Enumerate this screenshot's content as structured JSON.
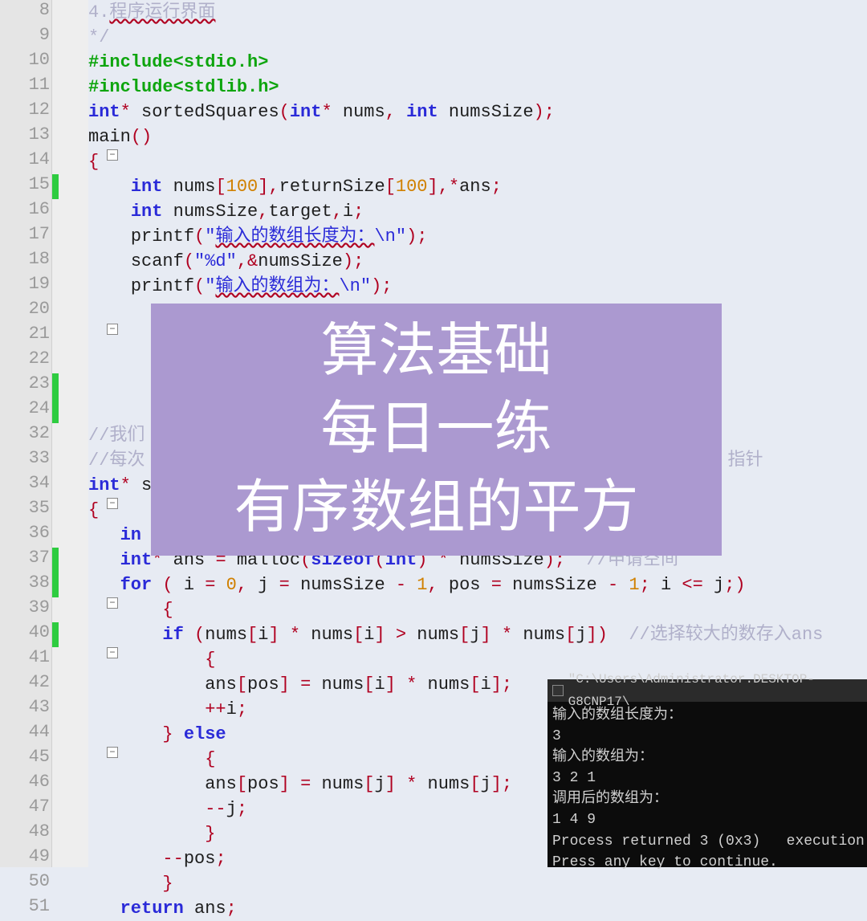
{
  "lines": [
    {
      "n": 8,
      "mark": "",
      "fold": "",
      "html": "<span class='cmt'>4.<span class='spell'>程序运行界面</span></span>"
    },
    {
      "n": 9,
      "mark": "",
      "fold": "",
      "html": "<span class='cmt'>*/</span>"
    },
    {
      "n": 10,
      "mark": "",
      "fold": "",
      "html": "<span class='green'>#include&lt;stdio.h&gt;</span>"
    },
    {
      "n": 11,
      "mark": "",
      "fold": "",
      "html": "<span class='green'>#include&lt;stdlib.h&gt;</span>"
    },
    {
      "n": 12,
      "mark": "",
      "fold": "",
      "html": "<span class='kw'>int</span><span class='op'>*</span> <span class='black'>sortedSquares</span><span class='op'>(</span><span class='kw'>int</span><span class='op'>*</span> <span class='black'>nums</span><span class='op'>,</span> <span class='kw'>int</span> <span class='black'>numsSize</span><span class='op'>);</span>"
    },
    {
      "n": 13,
      "mark": "",
      "fold": "",
      "html": "<span class='black'>main</span><span class='op'>()</span>"
    },
    {
      "n": 14,
      "mark": "",
      "fold": "−",
      "html": "<span class='op'>{</span>"
    },
    {
      "n": 15,
      "mark": "g",
      "fold": "",
      "html": "    <span class='kw'>int</span> <span class='black'>nums</span><span class='op'>[</span><span class='num'>100</span><span class='op'>],</span><span class='black'>returnSize</span><span class='op'>[</span><span class='num'>100</span><span class='op'>],*</span><span class='black'>ans</span><span class='op'>;</span>"
    },
    {
      "n": 16,
      "mark": "",
      "fold": "",
      "html": "    <span class='kw'>int</span> <span class='black'>numsSize</span><span class='op'>,</span><span class='black'>target</span><span class='op'>,</span><span class='black'>i</span><span class='op'>;</span>"
    },
    {
      "n": 17,
      "mark": "",
      "fold": "",
      "html": "    <span class='black'>printf</span><span class='op'>(</span><span class='str'>\"<span class='spell'>输入的数组长度为：</span>\\n\"</span><span class='op'>);</span>"
    },
    {
      "n": 18,
      "mark": "",
      "fold": "",
      "html": "    <span class='black'>scanf</span><span class='op'>(</span><span class='str'>\"%d\"</span><span class='op'>,&amp;</span><span class='black'>numsSize</span><span class='op'>);</span>"
    },
    {
      "n": 19,
      "mark": "",
      "fold": "",
      "html": "    <span class='black'>printf</span><span class='op'>(</span><span class='str'>\"<span class='spell'>输入的数组为：</span>\\n\"</span><span class='op'>);</span>"
    },
    {
      "n": 20,
      "mark": "",
      "fold": "",
      "html": ""
    },
    {
      "n": 21,
      "mark": "",
      "fold": "−",
      "html": ""
    },
    {
      "n": 22,
      "mark": "",
      "fold": "",
      "html": ""
    },
    {
      "n": 23,
      "mark": "g",
      "fold": "",
      "html": ""
    },
    {
      "n": 24,
      "mark": "g",
      "fold": "",
      "html": ""
    },
    {
      "n": 32,
      "mark": "",
      "fold": "",
      "html": "<span class='cmt'>//我们</span>"
    },
    {
      "n": 33,
      "mark": "",
      "fold": "",
      "html": "<span class='cmt'>//每次</span>                                                       <span class='cmt'>指针</span>"
    },
    {
      "n": 34,
      "mark": "",
      "fold": "",
      "html": "<span class='kw'>int</span><span class='op'>*</span> <span class='black'>s</span>"
    },
    {
      "n": 35,
      "mark": "",
      "fold": "−",
      "html": "<span class='op'>{</span>"
    },
    {
      "n": 36,
      "mark": "",
      "fold": "",
      "html": "   <span class='kw'>in</span>"
    },
    {
      "n": 37,
      "mark": "g",
      "fold": "",
      "html": "   <span class='kw'>int</span><span class='op'>*</span> <span class='black'>ans</span> <span class='op'>=</span> <span class='black'>malloc</span><span class='op'>(</span><span class='kw'>sizeof</span><span class='op'>(</span><span class='kw'>int</span><span class='op'>)</span> <span class='op'>*</span> <span class='black'>numsSize</span><span class='op'>);</span>  <span class='cmt'>//申请空间</span>"
    },
    {
      "n": 38,
      "mark": "g",
      "fold": "",
      "html": "   <span class='kw'>for</span> <span class='op'>(</span> <span class='black'>i</span> <span class='op'>=</span> <span class='num'>0</span><span class='op'>,</span> <span class='black'>j</span> <span class='op'>=</span> <span class='black'>numsSize</span> <span class='op'>-</span> <span class='num'>1</span><span class='op'>,</span> <span class='black'>pos</span> <span class='op'>=</span> <span class='black'>numsSize</span> <span class='op'>-</span> <span class='num'>1</span><span class='op'>;</span> <span class='black'>i</span> <span class='op'>&lt;=</span> <span class='black'>j</span><span class='op'>;)</span>"
    },
    {
      "n": 39,
      "mark": "",
      "fold": "−",
      "html": "       <span class='op'>{</span>"
    },
    {
      "n": 40,
      "mark": "g",
      "fold": "",
      "html": "       <span class='kw'>if</span> <span class='op'>(</span><span class='black'>nums</span><span class='op'>[</span><span class='black'>i</span><span class='op'>]</span> <span class='op'>*</span> <span class='black'>nums</span><span class='op'>[</span><span class='black'>i</span><span class='op'>]</span> <span class='op'>&gt;</span> <span class='black'>nums</span><span class='op'>[</span><span class='black'>j</span><span class='op'>]</span> <span class='op'>*</span> <span class='black'>nums</span><span class='op'>[</span><span class='black'>j</span><span class='op'>])</span>  <span class='cmt'>//选择较大的数存入ans</span>"
    },
    {
      "n": 41,
      "mark": "",
      "fold": "−",
      "html": "           <span class='op'>{</span>"
    },
    {
      "n": 42,
      "mark": "",
      "fold": "",
      "html": "           <span class='black'>ans</span><span class='op'>[</span><span class='black'>pos</span><span class='op'>]</span> <span class='op'>=</span> <span class='black'>nums</span><span class='op'>[</span><span class='black'>i</span><span class='op'>]</span> <span class='op'>*</span> <span class='black'>nums</span><span class='op'>[</span><span class='black'>i</span><span class='op'>];</span>"
    },
    {
      "n": 43,
      "mark": "",
      "fold": "",
      "html": "           <span class='op'>++</span><span class='black'>i</span><span class='op'>;</span>"
    },
    {
      "n": 44,
      "mark": "",
      "fold": "",
      "html": "       <span class='op'>}</span> <span class='kw'>else</span>"
    },
    {
      "n": 45,
      "mark": "",
      "fold": "−",
      "html": "           <span class='op'>{</span>"
    },
    {
      "n": 46,
      "mark": "",
      "fold": "",
      "html": "           <span class='black'>ans</span><span class='op'>[</span><span class='black'>pos</span><span class='op'>]</span> <span class='op'>=</span> <span class='black'>nums</span><span class='op'>[</span><span class='black'>j</span><span class='op'>]</span> <span class='op'>*</span> <span class='black'>nums</span><span class='op'>[</span><span class='black'>j</span><span class='op'>];</span>"
    },
    {
      "n": 47,
      "mark": "",
      "fold": "",
      "html": "           <span class='op'>--</span><span class='black'>j</span><span class='op'>;</span>"
    },
    {
      "n": 48,
      "mark": "",
      "fold": "",
      "html": "           <span class='op'>}</span>"
    },
    {
      "n": 49,
      "mark": "",
      "fold": "",
      "html": "       <span class='op'>--</span><span class='black'>pos</span><span class='op'>;</span>"
    },
    {
      "n": 50,
      "mark": "",
      "fold": "",
      "html": "       <span class='op'>}</span>"
    },
    {
      "n": 51,
      "mark": "",
      "fold": "",
      "html": "   <span class='kw'>return</span> <span class='black'>ans</span><span class='op'>;</span>"
    }
  ],
  "banner": {
    "line1": "算法基础",
    "line2": "每日一练",
    "line3": "有序数组的平方"
  },
  "console": {
    "title": "\"C:\\Users\\Administrator.DESKTOP-G8CNP17\\",
    "body": "输入的数组长度为：\n3\n输入的数组为：\n3 2 1\n调用后的数组为：\n1 4 9\nProcess returned 3 (0x3)   execution\nPress any key to continue."
  }
}
